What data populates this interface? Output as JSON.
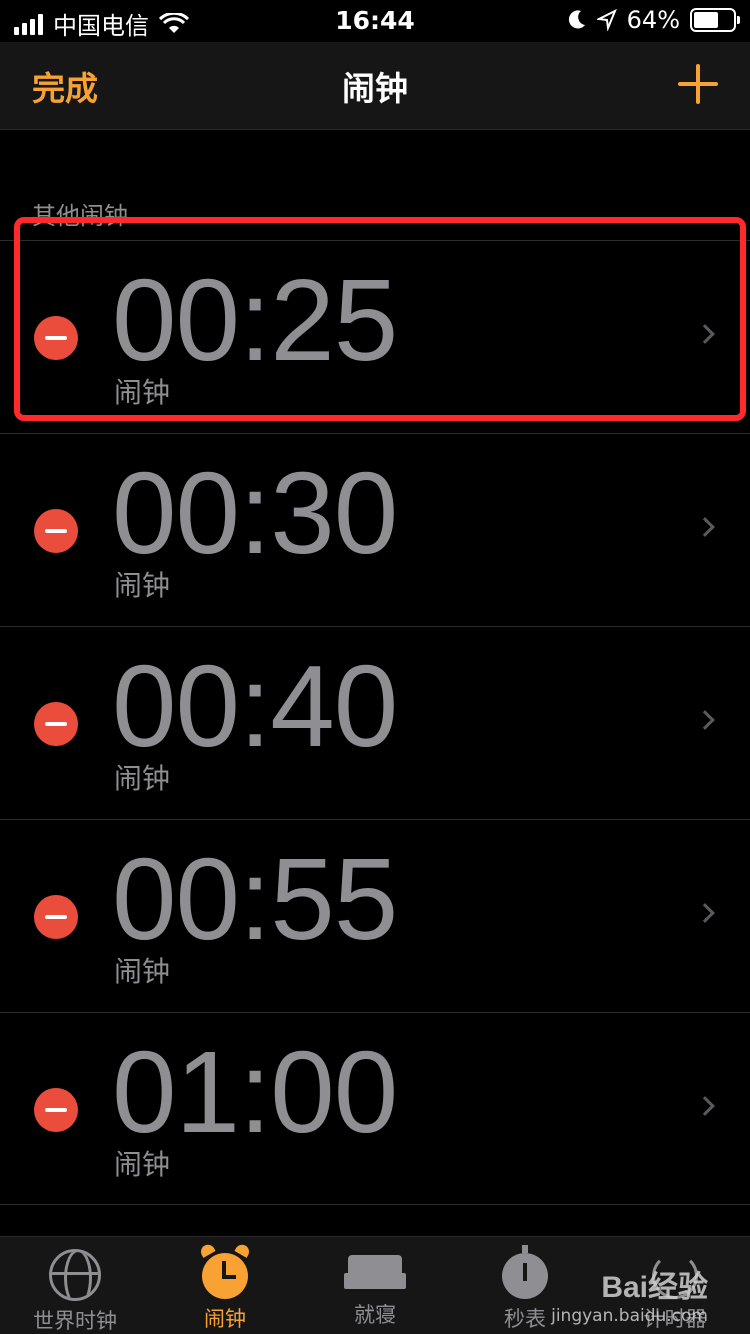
{
  "status_bar": {
    "carrier": "中国电信",
    "time": "16:44",
    "battery_percent": "64%",
    "battery_level": 0.64,
    "icons": [
      "signal-icon",
      "wifi-icon",
      "moon-icon",
      "location-icon",
      "battery-icon"
    ]
  },
  "nav": {
    "done_label": "完成",
    "title": "闹钟",
    "add_icon": "plus-icon"
  },
  "section_header": "其他闹钟",
  "alarms": [
    {
      "time": "00:25",
      "label": "闹钟"
    },
    {
      "time": "00:30",
      "label": "闹钟"
    },
    {
      "time": "00:40",
      "label": "闹钟"
    },
    {
      "time": "00:55",
      "label": "闹钟"
    },
    {
      "time": "01:00",
      "label": "闹钟"
    }
  ],
  "tabs": [
    {
      "label": "世界时钟",
      "icon": "globe-icon",
      "active": false
    },
    {
      "label": "闹钟",
      "icon": "alarm-clock-icon",
      "active": true
    },
    {
      "label": "就寝",
      "icon": "bed-icon",
      "active": false
    },
    {
      "label": "秒表",
      "icon": "stopwatch-icon",
      "active": false
    },
    {
      "label": "计时器",
      "icon": "timer-icon",
      "active": false
    }
  ],
  "watermark": {
    "brand": "Bai经验",
    "url": "jingyan.baidu.com"
  },
  "colors": {
    "accent": "#f7a233",
    "delete": "#eb4d3d",
    "highlight": "#ff2a2a",
    "secondary_text": "#8e8e93"
  }
}
